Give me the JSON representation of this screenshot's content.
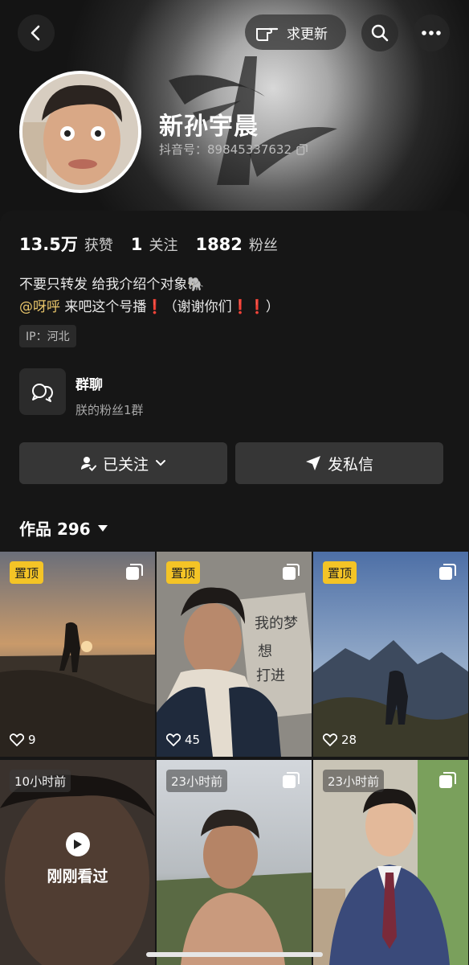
{
  "header": {
    "back_icon": "chevron-left-icon",
    "update_label": "求更新",
    "update_icon": "pointing-hand-icon",
    "search_icon": "search-icon",
    "more_icon": "more-icon"
  },
  "profile": {
    "name": "新孙宇晨",
    "douyin_id_label": "抖音号：",
    "douyin_id": "89845337632",
    "copy_icon": "copy-icon"
  },
  "stats": [
    {
      "value": "13.5万",
      "label": "获赞"
    },
    {
      "value": "1",
      "label": "关注"
    },
    {
      "value": "1882",
      "label": "粉丝"
    }
  ],
  "bio": {
    "line1": "不要只转发 给我介绍个对象🐘",
    "mention": "@呀呼",
    "line2_a": " 来吧这个号播",
    "mark1": "❗",
    "line2_b": "（谢谢你们",
    "mark2": "❗❗",
    "line2_c": "）"
  },
  "ip": "IP：河北",
  "group": {
    "icon": "chat-bubbles-icon",
    "title": "群聊",
    "subtitle": "朕的粉丝1群"
  },
  "actions": {
    "follow_label": "已关注",
    "message_label": "发私信"
  },
  "works_tab": {
    "label": "作品 296"
  },
  "tiles": [
    {
      "badge": "置顶",
      "badge_type": "pin",
      "likes": "9"
    },
    {
      "badge": "置顶",
      "badge_type": "pin",
      "likes": "45"
    },
    {
      "badge": "置顶",
      "badge_type": "pin",
      "likes": "28"
    },
    {
      "badge": "10小时前",
      "badge_type": "time",
      "overlay": "刚刚看过"
    },
    {
      "badge": "23小时前",
      "badge_type": "time"
    },
    {
      "badge": "23小时前",
      "badge_type": "time"
    }
  ],
  "colors": {
    "pin_badge": "#f4c426",
    "mention": "#e8c56a",
    "background": "#161616"
  }
}
